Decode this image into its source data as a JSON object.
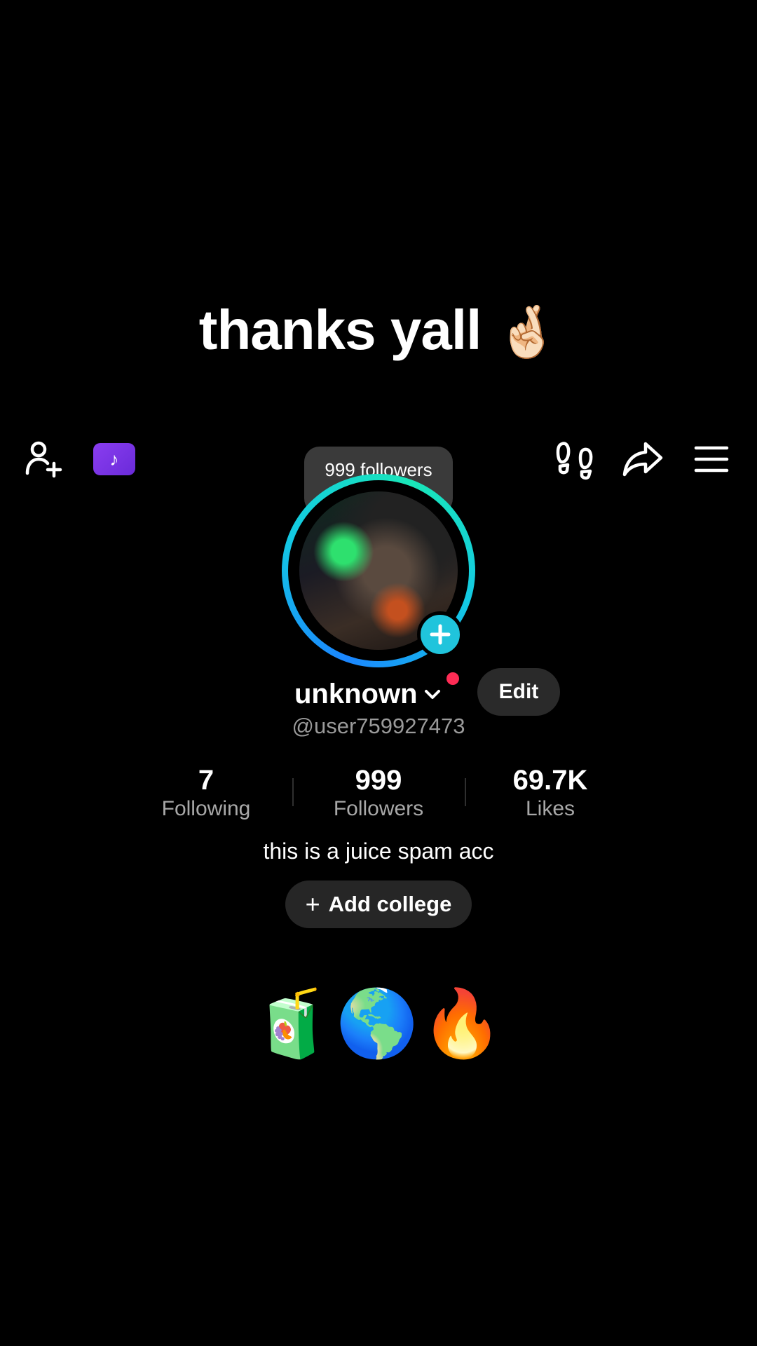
{
  "caption": {
    "text": "thanks yall",
    "emoji": "🤞🏻"
  },
  "top_bar": {
    "icons": [
      "add-friend-icon",
      "tiktok-ticket-icon",
      "footprint-icon",
      "share-icon",
      "menu-icon"
    ],
    "ticket_glyph": "♪"
  },
  "tooltip": {
    "text": "999 followers",
    "emojis": "🧃🌎"
  },
  "profile": {
    "display_name": "unknown",
    "edit_label": "Edit",
    "username": "@user759927473",
    "accent": "#fe2c55",
    "avatar_ring_colors": [
      "#1b86ff",
      "#19e6b8"
    ]
  },
  "stats": [
    {
      "value": "7",
      "label": "Following"
    },
    {
      "value": "999",
      "label": "Followers"
    },
    {
      "value": "69.7K",
      "label": "Likes"
    }
  ],
  "bio": "this is a juice spam acc",
  "college_button": {
    "plus": "+",
    "label": "Add college"
  },
  "emoji_row": "🧃🌎🔥"
}
